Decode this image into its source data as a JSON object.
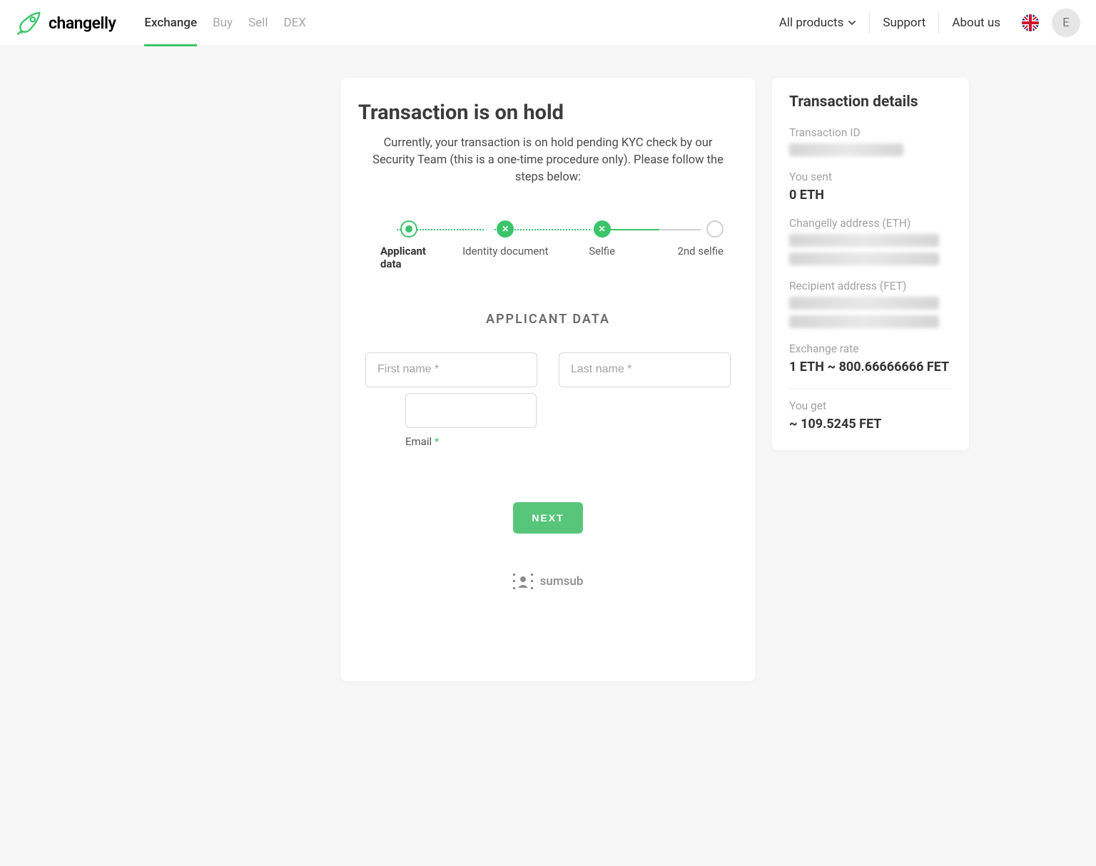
{
  "brand": "changelly",
  "nav": {
    "exchange": "Exchange",
    "buy": "Buy",
    "sell": "Sell",
    "dex": "DEX",
    "all_products": "All products",
    "support": "Support",
    "about": "About us"
  },
  "avatar_initial": "E",
  "main": {
    "title": "Transaction is on hold",
    "desc": "Currently, your transaction is on hold pending KYC check by our Security Team (this is a one-time procedure only). Please follow the steps below:"
  },
  "stepper": {
    "s1": "Applicant data",
    "s2": "Identity document",
    "s3": "Selfie",
    "s4": "2nd selfie"
  },
  "form": {
    "heading": "APPLICANT DATA",
    "first_name_ph": "First name *",
    "last_name_ph": "Last name *",
    "email_label": "Email",
    "next": "NEXT"
  },
  "provider": "sumsub",
  "details": {
    "title": "Transaction details",
    "tx_id_label": "Transaction ID",
    "you_sent_label": "You sent",
    "you_sent_value": "0 ETH",
    "changelly_addr_label": "Changelly address (ETH)",
    "recipient_addr_label": "Recipient address (FET)",
    "rate_label": "Exchange rate",
    "rate_value": "1 ETH ~ 800.66666666 FET",
    "you_get_label": "You get",
    "you_get_value": "~ 109.5245 FET"
  }
}
